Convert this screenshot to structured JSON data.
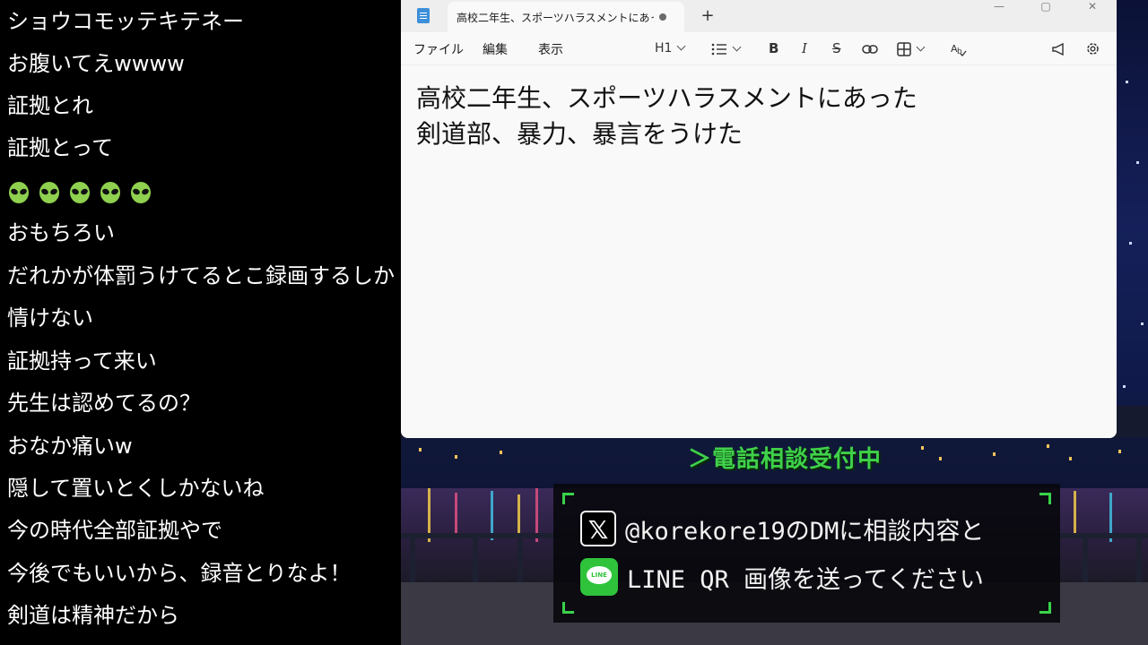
{
  "chat": {
    "messages": [
      "ショウコモッテキテネー",
      "お腹いてえwwww",
      "証拠とれ",
      "証拠とって",
      "",
      "おもちろい",
      "だれかが体罰うけてるとこ録画するしか",
      "情けない",
      "証拠持って来い",
      "先生は認めてるの？",
      "おなか痛いw",
      "隠して置いとくしかないね",
      "今の時代全部証拠やで",
      "今後でもいいから、録音とりなよ！",
      "剣道は精神だから"
    ],
    "emoji_row": {
      "icon": "alien-emoji-icon",
      "count": 5
    }
  },
  "notepad": {
    "tab_title": "高校二年生、スポーツハラスメントにあった",
    "new_tab": "+",
    "window_controls": {
      "minimize": "—",
      "maximize": "▢",
      "close": "✕"
    },
    "menu": {
      "file": "ファイル",
      "edit": "編集",
      "view": "表示"
    },
    "toolbar": {
      "heading": "H1",
      "bold": "B",
      "italic": "I",
      "strikethrough": "S",
      "icons": [
        "list-icon",
        "link-icon",
        "table-icon",
        "spellcheck-icon",
        "announcement-icon",
        "gear-icon"
      ]
    },
    "content": [
      "高校二年生、スポーツハラスメントにあった",
      "剣道部、暴力、暴言をうけた"
    ]
  },
  "overlay": {
    "phone_banner": "＞電話相談受付中",
    "contact": {
      "x_logo": "𝕏",
      "x_line": "@korekore19のDMに相談内容と",
      "line_logo": "LINE",
      "line_line": "LINE QR 画像を送ってください"
    }
  },
  "colors": {
    "accent_green": "#39d24a",
    "line_green": "#2fc33c",
    "chat_bg": "#000000",
    "editor_bg": "#f9f9f9"
  }
}
